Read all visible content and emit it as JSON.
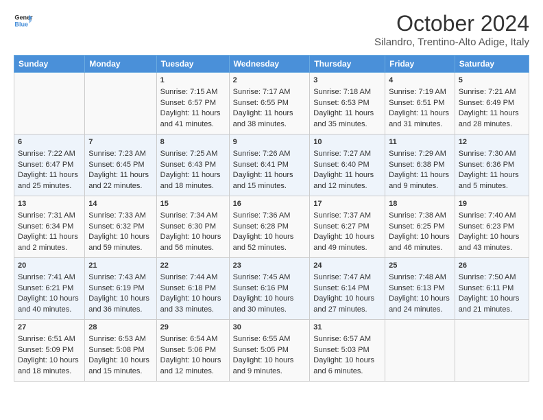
{
  "header": {
    "logo_line1": "General",
    "logo_line2": "Blue",
    "month": "October 2024",
    "location": "Silandro, Trentino-Alto Adige, Italy"
  },
  "days_of_week": [
    "Sunday",
    "Monday",
    "Tuesday",
    "Wednesday",
    "Thursday",
    "Friday",
    "Saturday"
  ],
  "weeks": [
    [
      {
        "day": "",
        "content": ""
      },
      {
        "day": "",
        "content": ""
      },
      {
        "day": "1",
        "content": "Sunrise: 7:15 AM\nSunset: 6:57 PM\nDaylight: 11 hours and 41 minutes."
      },
      {
        "day": "2",
        "content": "Sunrise: 7:17 AM\nSunset: 6:55 PM\nDaylight: 11 hours and 38 minutes."
      },
      {
        "day": "3",
        "content": "Sunrise: 7:18 AM\nSunset: 6:53 PM\nDaylight: 11 hours and 35 minutes."
      },
      {
        "day": "4",
        "content": "Sunrise: 7:19 AM\nSunset: 6:51 PM\nDaylight: 11 hours and 31 minutes."
      },
      {
        "day": "5",
        "content": "Sunrise: 7:21 AM\nSunset: 6:49 PM\nDaylight: 11 hours and 28 minutes."
      }
    ],
    [
      {
        "day": "6",
        "content": "Sunrise: 7:22 AM\nSunset: 6:47 PM\nDaylight: 11 hours and 25 minutes."
      },
      {
        "day": "7",
        "content": "Sunrise: 7:23 AM\nSunset: 6:45 PM\nDaylight: 11 hours and 22 minutes."
      },
      {
        "day": "8",
        "content": "Sunrise: 7:25 AM\nSunset: 6:43 PM\nDaylight: 11 hours and 18 minutes."
      },
      {
        "day": "9",
        "content": "Sunrise: 7:26 AM\nSunset: 6:41 PM\nDaylight: 11 hours and 15 minutes."
      },
      {
        "day": "10",
        "content": "Sunrise: 7:27 AM\nSunset: 6:40 PM\nDaylight: 11 hours and 12 minutes."
      },
      {
        "day": "11",
        "content": "Sunrise: 7:29 AM\nSunset: 6:38 PM\nDaylight: 11 hours and 9 minutes."
      },
      {
        "day": "12",
        "content": "Sunrise: 7:30 AM\nSunset: 6:36 PM\nDaylight: 11 hours and 5 minutes."
      }
    ],
    [
      {
        "day": "13",
        "content": "Sunrise: 7:31 AM\nSunset: 6:34 PM\nDaylight: 11 hours and 2 minutes."
      },
      {
        "day": "14",
        "content": "Sunrise: 7:33 AM\nSunset: 6:32 PM\nDaylight: 10 hours and 59 minutes."
      },
      {
        "day": "15",
        "content": "Sunrise: 7:34 AM\nSunset: 6:30 PM\nDaylight: 10 hours and 56 minutes."
      },
      {
        "day": "16",
        "content": "Sunrise: 7:36 AM\nSunset: 6:28 PM\nDaylight: 10 hours and 52 minutes."
      },
      {
        "day": "17",
        "content": "Sunrise: 7:37 AM\nSunset: 6:27 PM\nDaylight: 10 hours and 49 minutes."
      },
      {
        "day": "18",
        "content": "Sunrise: 7:38 AM\nSunset: 6:25 PM\nDaylight: 10 hours and 46 minutes."
      },
      {
        "day": "19",
        "content": "Sunrise: 7:40 AM\nSunset: 6:23 PM\nDaylight: 10 hours and 43 minutes."
      }
    ],
    [
      {
        "day": "20",
        "content": "Sunrise: 7:41 AM\nSunset: 6:21 PM\nDaylight: 10 hours and 40 minutes."
      },
      {
        "day": "21",
        "content": "Sunrise: 7:43 AM\nSunset: 6:19 PM\nDaylight: 10 hours and 36 minutes."
      },
      {
        "day": "22",
        "content": "Sunrise: 7:44 AM\nSunset: 6:18 PM\nDaylight: 10 hours and 33 minutes."
      },
      {
        "day": "23",
        "content": "Sunrise: 7:45 AM\nSunset: 6:16 PM\nDaylight: 10 hours and 30 minutes."
      },
      {
        "day": "24",
        "content": "Sunrise: 7:47 AM\nSunset: 6:14 PM\nDaylight: 10 hours and 27 minutes."
      },
      {
        "day": "25",
        "content": "Sunrise: 7:48 AM\nSunset: 6:13 PM\nDaylight: 10 hours and 24 minutes."
      },
      {
        "day": "26",
        "content": "Sunrise: 7:50 AM\nSunset: 6:11 PM\nDaylight: 10 hours and 21 minutes."
      }
    ],
    [
      {
        "day": "27",
        "content": "Sunrise: 6:51 AM\nSunset: 5:09 PM\nDaylight: 10 hours and 18 minutes."
      },
      {
        "day": "28",
        "content": "Sunrise: 6:53 AM\nSunset: 5:08 PM\nDaylight: 10 hours and 15 minutes."
      },
      {
        "day": "29",
        "content": "Sunrise: 6:54 AM\nSunset: 5:06 PM\nDaylight: 10 hours and 12 minutes."
      },
      {
        "day": "30",
        "content": "Sunrise: 6:55 AM\nSunset: 5:05 PM\nDaylight: 10 hours and 9 minutes."
      },
      {
        "day": "31",
        "content": "Sunrise: 6:57 AM\nSunset: 5:03 PM\nDaylight: 10 hours and 6 minutes."
      },
      {
        "day": "",
        "content": ""
      },
      {
        "day": "",
        "content": ""
      }
    ]
  ]
}
